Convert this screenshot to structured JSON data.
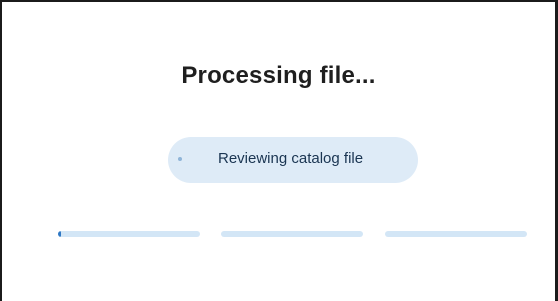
{
  "dialog": {
    "title": "Processing file...",
    "status_text": "Reviewing catalog file"
  },
  "progress": {
    "steps": [
      {
        "fill_percent": 2
      },
      {
        "fill_percent": 0
      },
      {
        "fill_percent": 0
      }
    ]
  },
  "colors": {
    "pill_background": "#deebf7",
    "track": "#d3e6f6",
    "fill": "#2f78c4",
    "title_text": "#1f1f1f",
    "status_text": "#1a3552"
  }
}
